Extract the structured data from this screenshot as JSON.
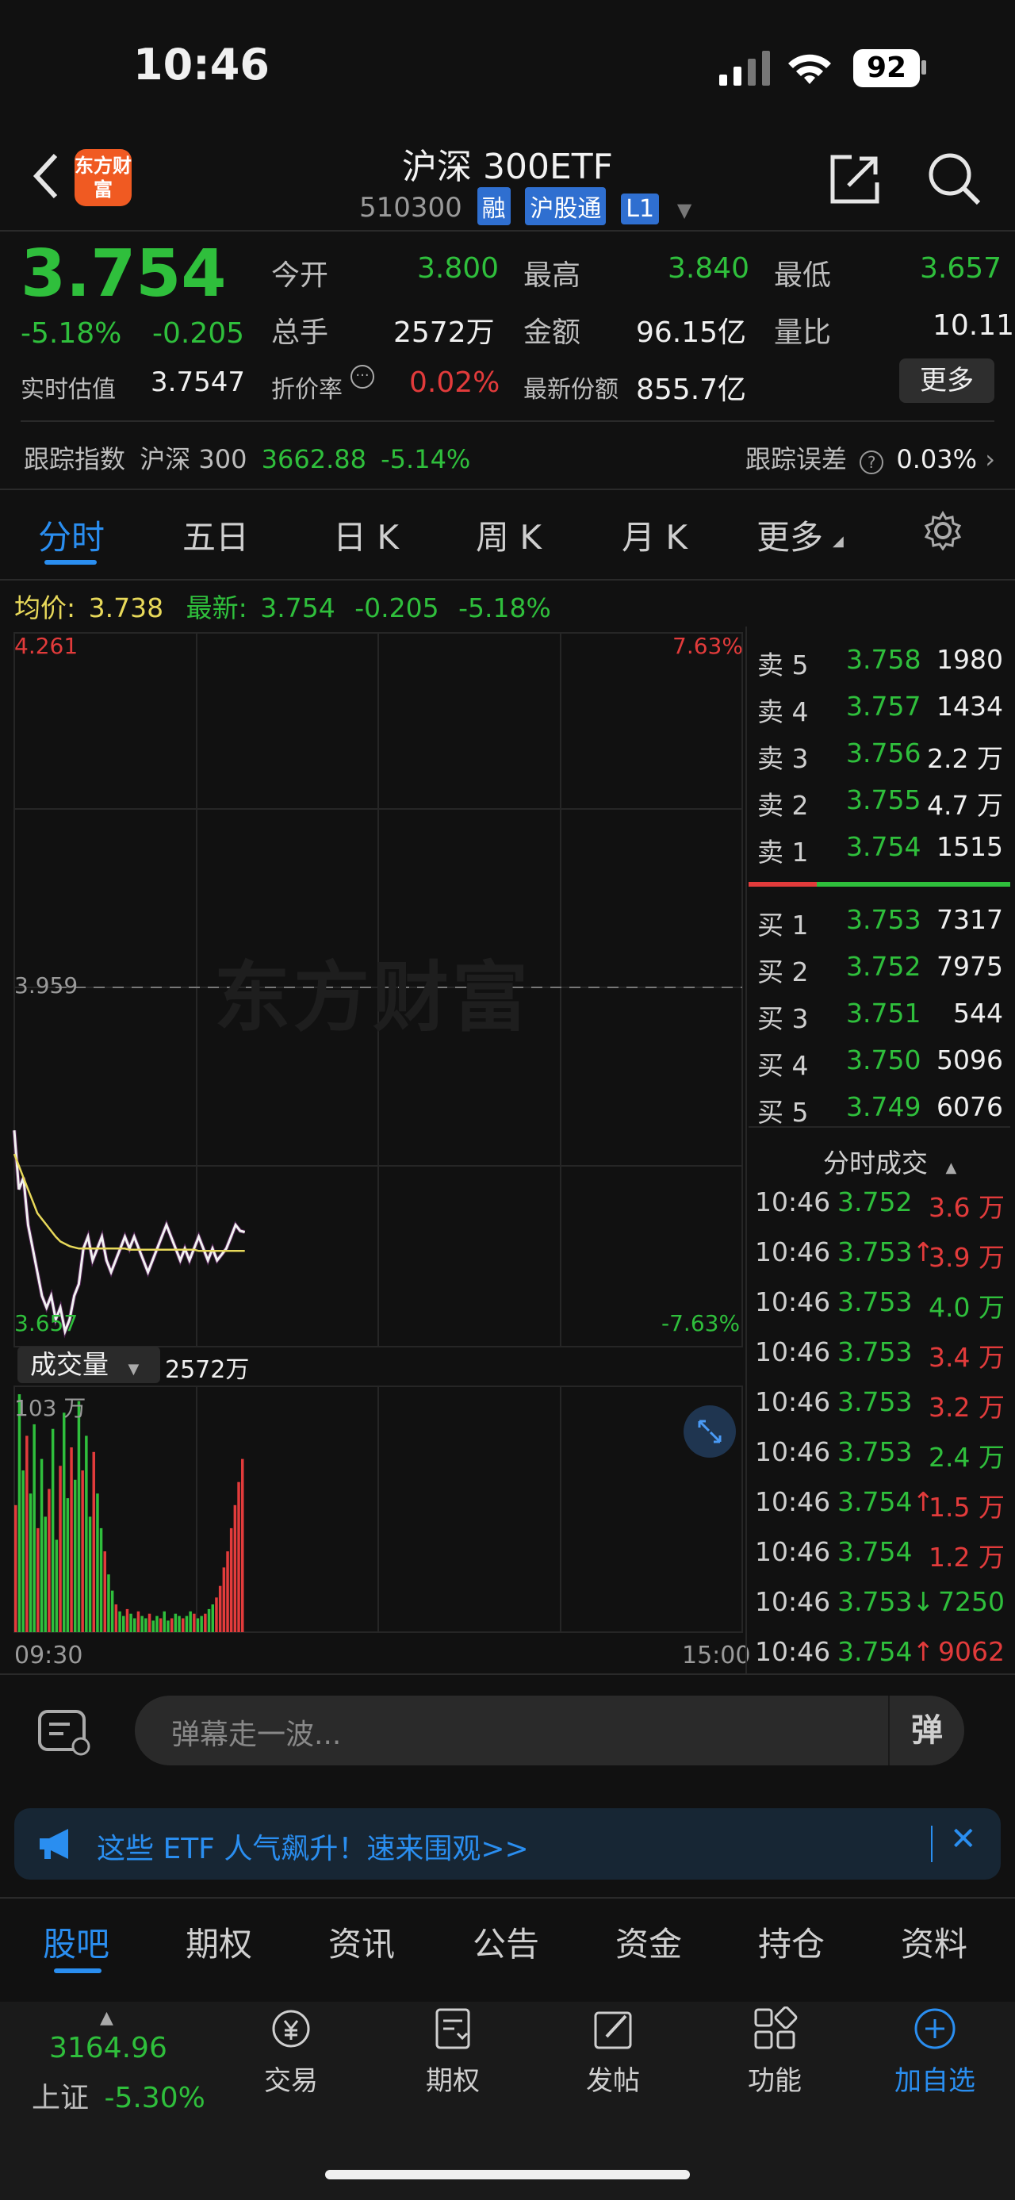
{
  "status_bar": {
    "time": "10:46",
    "battery": "92"
  },
  "header": {
    "title": "沪深 300ETF",
    "code": "510300",
    "tags": [
      "融",
      "沪股通",
      "L1"
    ],
    "logo_text": "东方财富"
  },
  "quote": {
    "price": "3.754",
    "change_pct": "-5.18%",
    "change": "-0.205",
    "realtime_label": "实时估值",
    "realtime_value": "3.7547",
    "open_label": "今开",
    "open": "3.800",
    "high_label": "最高",
    "high": "3.840",
    "low_label": "最低",
    "low": "3.657",
    "volume_label": "总手",
    "volume": "2572万",
    "amount_label": "金额",
    "amount": "96.15亿",
    "ratio_label": "量比",
    "ratio": "10.11",
    "discount_label": "折价率",
    "discount": "0.02%",
    "shares_label": "最新份额",
    "shares": "855.7亿",
    "more_button": "更多"
  },
  "tracking": {
    "label": "跟踪指数",
    "index_name": "沪深 300",
    "index_value": "3662.88",
    "index_change": "-5.14%",
    "error_label": "跟踪误差",
    "error_value": "0.03%"
  },
  "chart_tabs": [
    "分时",
    "五日",
    "日 K",
    "周 K",
    "月 K",
    "更多"
  ],
  "avg_line": {
    "avg_label": "均价:",
    "avg_value": "3.738",
    "latest_label": "最新:",
    "latest_value": "3.754",
    "latest_change": "-0.205",
    "latest_pct": "-5.18%"
  },
  "chart_labels": {
    "top_price": "4.261",
    "top_pct": "7.63%",
    "mid_price": "3.959",
    "bottom_price": "3.657",
    "bottom_pct": "-7.63%",
    "watermark": "东方财富"
  },
  "volume_panel": {
    "label": "成交量",
    "total": "2572万",
    "max": "103 万",
    "start_time": "09:30",
    "end_time": "15:00"
  },
  "order_book": {
    "asks": [
      {
        "label": "卖 5",
        "price": "3.758",
        "vol": "1980"
      },
      {
        "label": "卖 4",
        "price": "3.757",
        "vol": "1434"
      },
      {
        "label": "卖 3",
        "price": "3.756",
        "vol": "2.2 万"
      },
      {
        "label": "卖 2",
        "price": "3.755",
        "vol": "4.7 万"
      },
      {
        "label": "卖 1",
        "price": "3.754",
        "vol": "1515"
      }
    ],
    "bids": [
      {
        "label": "买 1",
        "price": "3.753",
        "vol": "7317"
      },
      {
        "label": "买 2",
        "price": "3.752",
        "vol": "7975"
      },
      {
        "label": "买 3",
        "price": "3.751",
        "vol": "544"
      },
      {
        "label": "买 4",
        "price": "3.750",
        "vol": "5096"
      },
      {
        "label": "买 5",
        "price": "3.749",
        "vol": "6076"
      }
    ]
  },
  "trades_title": "分时成交",
  "trades": [
    {
      "time": "10:46",
      "price": "3.752",
      "arrow": "",
      "vol": "3.6 万",
      "color": "red"
    },
    {
      "time": "10:46",
      "price": "3.753",
      "arrow": "↑",
      "vol": "3.9 万",
      "color": "red"
    },
    {
      "time": "10:46",
      "price": "3.753",
      "arrow": "",
      "vol": "4.0 万",
      "color": "green"
    },
    {
      "time": "10:46",
      "price": "3.753",
      "arrow": "",
      "vol": "3.4 万",
      "color": "red"
    },
    {
      "time": "10:46",
      "price": "3.753",
      "arrow": "",
      "vol": "3.2 万",
      "color": "red"
    },
    {
      "time": "10:46",
      "price": "3.753",
      "arrow": "",
      "vol": "2.4 万",
      "color": "green"
    },
    {
      "time": "10:46",
      "price": "3.754",
      "arrow": "↑",
      "vol": "1.5 万",
      "color": "red"
    },
    {
      "time": "10:46",
      "price": "3.754",
      "arrow": "",
      "vol": "1.2 万",
      "color": "red"
    },
    {
      "time": "10:46",
      "price": "3.753",
      "arrow": "↓",
      "vol": "7250",
      "color": "green"
    },
    {
      "time": "10:46",
      "price": "3.754",
      "arrow": "↑",
      "vol": "9062",
      "color": "red"
    }
  ],
  "comment": {
    "placeholder": "弹幕走一波...",
    "danmu_icon": "弹"
  },
  "banner": {
    "text": "这些 ETF 人气飙升！速来围观>>"
  },
  "bottom_tabs": [
    "股吧",
    "期权",
    "资讯",
    "公告",
    "资金",
    "持仓",
    "资料"
  ],
  "bottom_nav": {
    "index_value": "3164.96",
    "index_name": "上证",
    "index_change": "-5.30%",
    "items": [
      "交易",
      "期权",
      "发帖",
      "功能",
      "加自选"
    ]
  },
  "chart_data": {
    "type": "line",
    "x_range": [
      "09:30",
      "15:00"
    ],
    "ylim": [
      3.657,
      4.261
    ],
    "reference_price": 3.959,
    "series": [
      {
        "name": "",
        "values": [
          3.84,
          3.79,
          3.8,
          3.76,
          3.74,
          3.72,
          3.7,
          3.69,
          3.7,
          3.68,
          3.69,
          3.67,
          3.68,
          3.7,
          3.71,
          3.74,
          3.75,
          3.73,
          3.74,
          3.75,
          3.73,
          3.72,
          3.73,
          3.74,
          3.75,
          3.74,
          3.75,
          3.74,
          3.73,
          3.72,
          3.73,
          3.74,
          3.75,
          3.76,
          3.75,
          3.74,
          3.73,
          3.74,
          3.73,
          3.74,
          3.75,
          3.74,
          3.73,
          3.74,
          3.73,
          3.735,
          3.74,
          3.75,
          3.76,
          3.755,
          3.754
        ]
      },
      {
        "name": "均价",
        "values": [
          3.82,
          3.81,
          3.8,
          3.79,
          3.78,
          3.77,
          3.765,
          3.76,
          3.755,
          3.75,
          3.746,
          3.744,
          3.742,
          3.741,
          3.74,
          3.74,
          3.74,
          3.74,
          3.74,
          3.74,
          3.74,
          3.74,
          3.74,
          3.74,
          3.74,
          3.739,
          3.739,
          3.739,
          3.739,
          3.739,
          3.739,
          3.739,
          3.739,
          3.739,
          3.739,
          3.739,
          3.739,
          3.739,
          3.739,
          3.739,
          3.738,
          3.738,
          3.738,
          3.738,
          3.738,
          3.738,
          3.738,
          3.738,
          3.738,
          3.738,
          3.738
        ]
      }
    ],
    "volume": [
      55,
      103,
      70,
      85,
      60,
      90,
      45,
      75,
      50,
      62,
      88,
      40,
      72,
      95,
      58,
      80,
      66,
      100,
      70,
      85,
      50,
      78,
      60,
      45,
      35,
      25,
      18,
      12,
      9,
      7,
      10,
      8,
      6,
      9,
      7,
      6,
      8,
      5,
      7,
      6,
      9,
      5,
      6,
      8,
      7,
      6,
      7,
      9,
      8,
      6,
      7,
      8,
      10,
      12,
      15,
      20,
      28,
      35,
      45,
      55,
      65,
      75
    ]
  }
}
